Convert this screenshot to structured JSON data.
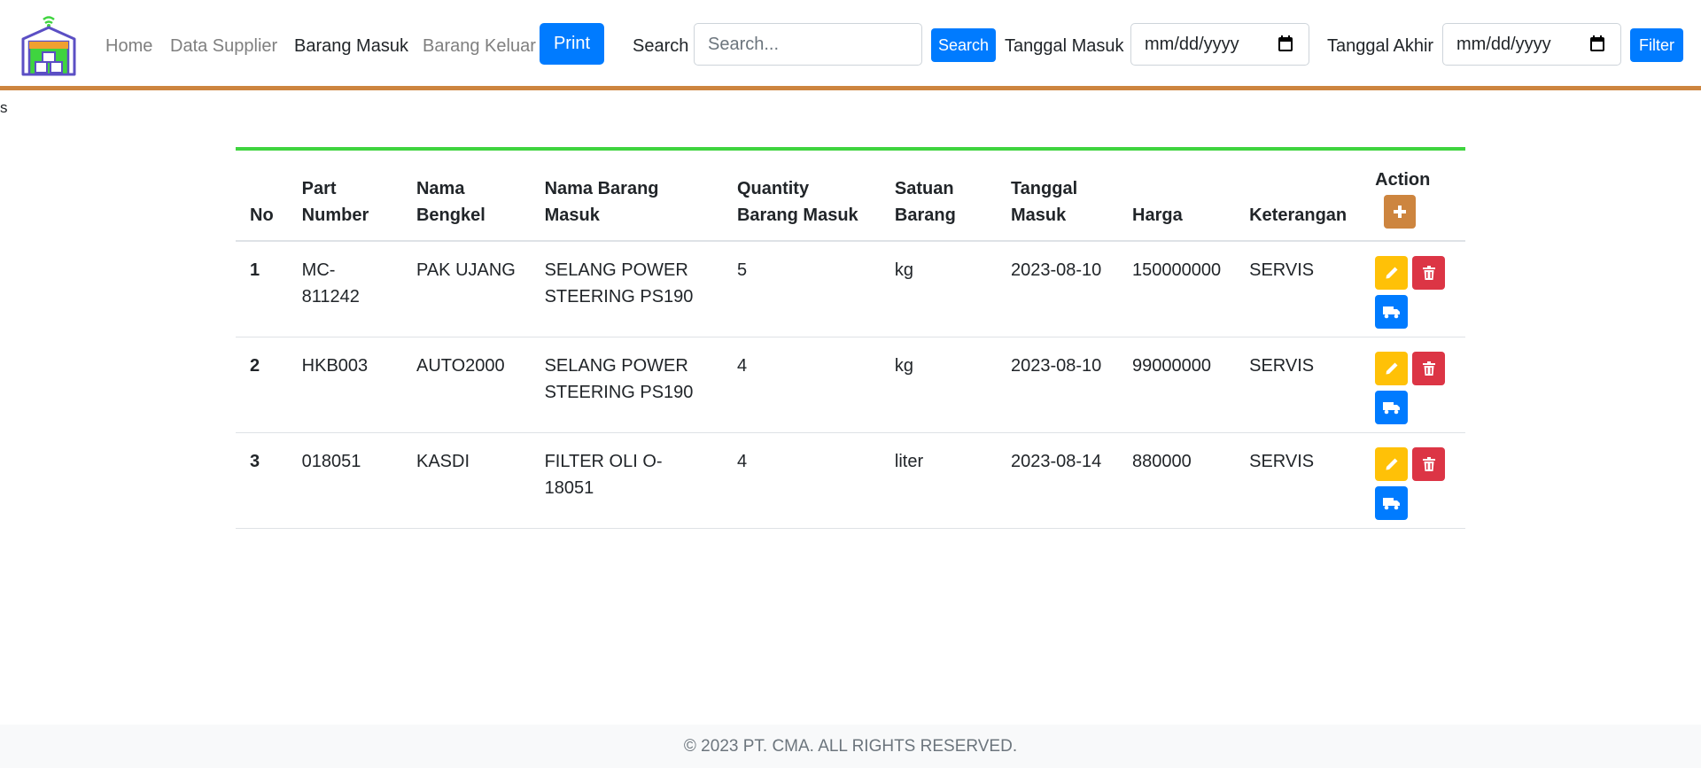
{
  "nav": {
    "links": [
      "Home",
      "Data Supplier",
      "Barang Masuk",
      "Barang Keluar"
    ],
    "active": "Barang Masuk",
    "print_label": "Print",
    "search_label": "Search",
    "search_placeholder": "Search...",
    "search_button": "Search",
    "tanggal_masuk_label": "Tanggal Masuk",
    "tanggal_masuk_placeholder": "mm/dd/yyyy",
    "tanggal_akhir_label": "Tanggal Akhir",
    "tanggal_akhir_placeholder": "mm/dd/yyyy",
    "filter_button": "Filter"
  },
  "stray_text": "s",
  "table": {
    "headers": [
      "No",
      "Part Number",
      "Nama Bengkel",
      "Nama Barang Masuk",
      "Quantity Barang Masuk",
      "Satuan Barang",
      "Tanggal Masuk",
      "Harga",
      "Keterangan",
      "Action"
    ],
    "rows": [
      {
        "no": "1",
        "part_number": "MC-811242",
        "nama_bengkel": "PAK UJANG",
        "nama_barang": "SELANG POWER STEERING PS190",
        "quantity": "5",
        "satuan": "kg",
        "tanggal": "2023-08-10",
        "harga": "150000000",
        "keterangan": "SERVIS"
      },
      {
        "no": "2",
        "part_number": "HKB003",
        "nama_bengkel": "AUTO2000",
        "nama_barang": "SELANG POWER STEERING PS190",
        "quantity": "4",
        "satuan": "kg",
        "tanggal": "2023-08-10",
        "harga": "99000000",
        "keterangan": "SERVIS"
      },
      {
        "no": "3",
        "part_number": "018051",
        "nama_bengkel": "KASDI",
        "nama_barang": "FILTER OLI O-18051",
        "quantity": "4",
        "satuan": "liter",
        "tanggal": "2023-08-14",
        "harga": "880000",
        "keterangan": "SERVIS"
      }
    ]
  },
  "footer": "© 2023 PT. CMA. ALL RIGHTS RESERVED.",
  "colors": {
    "primary": "#007bff",
    "accent": "#cd853f",
    "green_line": "#3fd43f",
    "warning": "#ffc107",
    "danger": "#dc3545"
  },
  "icons": {
    "logo": "warehouse-logo-icon",
    "add": "plus-icon",
    "edit": "pencil-icon",
    "delete": "trash-icon",
    "ship": "truck-icon",
    "calendar": "calendar-icon"
  }
}
